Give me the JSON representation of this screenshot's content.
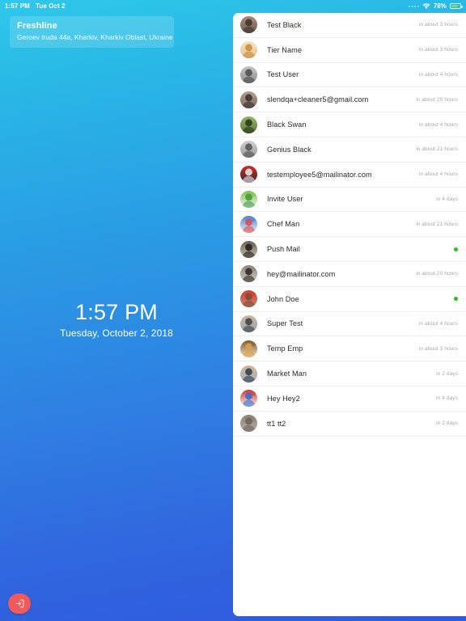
{
  "status_bar": {
    "time": "1:57 PM",
    "date": "Tue Oct 2",
    "wifi_icon": "wifi-icon",
    "battery_percent": "78%",
    "battery_icon": "battery-icon",
    "battery_level": 78
  },
  "left_panel": {
    "org_card": {
      "name": "Freshline",
      "address": "Geroev truda 44a, Kharkiv, Kharkiv Oblast, Ukraine"
    },
    "clock": {
      "time": "1:57 PM",
      "date": "Tuesday, October 2, 2018"
    },
    "logout_button": {
      "icon": "logout-icon",
      "label": "",
      "color": "#f05a5a"
    },
    "gradient": {
      "from": "#2ec9ea",
      "to": "#3059dd"
    }
  },
  "contact_list": {
    "online_color": "#24c024",
    "rows": [
      {
        "name": "Test Black",
        "meta": "in about 3 hours",
        "online": false,
        "avatar": "avatar-bearded-man"
      },
      {
        "name": "Tier Name",
        "meta": "in about 3 hours",
        "online": false,
        "avatar": "avatar-food-plate"
      },
      {
        "name": "Test User",
        "meta": "in about 4 hours",
        "online": false,
        "avatar": "avatar-grayscale-man"
      },
      {
        "name": "slendqa+cleaner5@gmail.com",
        "meta": "in about 20 hours",
        "online": false,
        "avatar": "avatar-older-man"
      },
      {
        "name": "Black Swan",
        "meta": "in about 4 hours",
        "online": false,
        "avatar": "avatar-green-nature"
      },
      {
        "name": "Genius Black",
        "meta": "in about 21 hours",
        "online": false,
        "avatar": "avatar-grayscale-portrait"
      },
      {
        "name": "testemployee5@mailinator.com",
        "meta": "in about 4 hours",
        "online": false,
        "avatar": "avatar-checker-pattern"
      },
      {
        "name": "Invite User",
        "meta": "in 4 days",
        "online": false,
        "avatar": "avatar-green-crocodile"
      },
      {
        "name": "Chef Man",
        "meta": "in about 21 hours",
        "online": false,
        "avatar": "avatar-chefs-illustration"
      },
      {
        "name": "Push Mail",
        "meta": "",
        "online": true,
        "avatar": "avatar-dark-figure"
      },
      {
        "name": "hey@mailinator.com",
        "meta": "in about 20 hours",
        "online": false,
        "avatar": "avatar-mask-face"
      },
      {
        "name": "John Doe",
        "meta": "",
        "online": true,
        "avatar": "avatar-man-red-cap"
      },
      {
        "name": "Super Test",
        "meta": "in about 4 hours",
        "online": false,
        "avatar": "avatar-suited-man"
      },
      {
        "name": "Temp Emp",
        "meta": "in about 3 hours",
        "online": false,
        "avatar": "avatar-cartoon-face"
      },
      {
        "name": "Market Man",
        "meta": "in 2 days",
        "online": false,
        "avatar": "avatar-businessman"
      },
      {
        "name": "Hey Hey2",
        "meta": "in 4 days",
        "online": false,
        "avatar": "avatar-colorful-balloons"
      },
      {
        "name": "tt1 tt2",
        "meta": "in 2 days",
        "online": false,
        "avatar": "avatar-bald-man"
      }
    ]
  }
}
